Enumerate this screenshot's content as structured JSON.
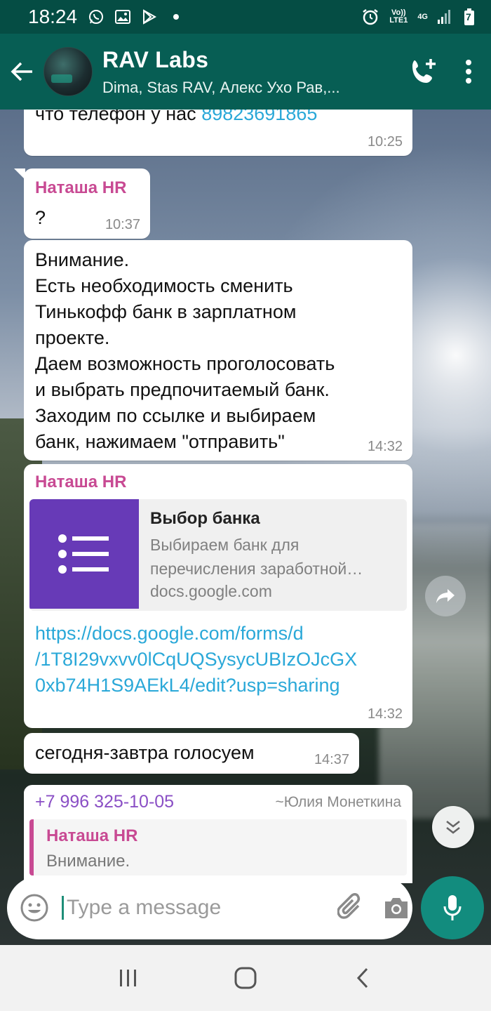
{
  "status_bar": {
    "time": "18:24",
    "volte": "Vo)) LTE1",
    "network": "4G",
    "battery": "7"
  },
  "header": {
    "title": "RAV Labs",
    "subtitle": "Dima, Stas RAV, Алекс Ухо Рав,..."
  },
  "messages": [
    {
      "partial_text": "что телефон у нас ",
      "link": "89823691865",
      "time": "10:25"
    },
    {
      "sender": "Наташа HR",
      "text": "?",
      "time": "10:37"
    },
    {
      "lines": [
        "Внимание.",
        "Есть необходимость сменить",
        "Тинькофф банк в зарплатном",
        "проекте.",
        "Даем возможность проголосовать",
        "и выбрать предпочитаемый банк.",
        "Заходим по ссылке и выбираем",
        "банк, нажимаем \"отправить\""
      ],
      "time": "14:32"
    },
    {
      "sender": "Наташа HR",
      "card": {
        "title": "Выбор банка",
        "desc_line1": "Выбираем банк для",
        "desc_line2": "перечисления заработной…",
        "domain": "docs.google.com"
      },
      "link_lines": [
        "https://docs.google.com/forms/d",
        "/1T8I29vxvv0lCqUQSysycUBIzOJcGX",
        "0xb74H1S9AEkL4/edit?usp=sharing"
      ],
      "time": "14:32"
    },
    {
      "text": "сегодня-завтра голосуем",
      "time": "14:37"
    },
    {
      "sender_phone": "+7 996 325-10-05",
      "sender_name": "~Юлия Монеткина",
      "quote_sender": "Наташа HR",
      "quote_text": "Внимание."
    }
  ],
  "input": {
    "placeholder": "Type a message"
  },
  "colors": {
    "header": "#075e54",
    "accent": "#128c7e",
    "sender": "#c84a93",
    "link": "#2aa8d8"
  }
}
